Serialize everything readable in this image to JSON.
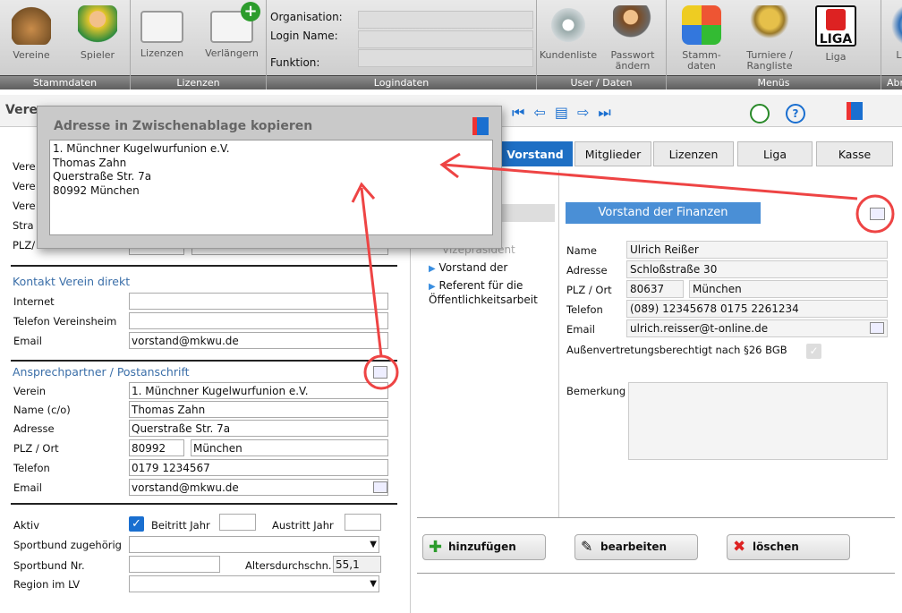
{
  "toolbar": {
    "groups": [
      {
        "footer": "Stammdaten",
        "buttons": [
          "Vereine",
          "Spieler"
        ]
      },
      {
        "footer": "Lizenzen",
        "buttons": [
          "Lizenzen",
          "Verlängern"
        ]
      },
      {
        "footer": "Logindaten",
        "labels": [
          "Organisation:",
          "Login Name:",
          "Funktion:"
        ]
      },
      {
        "footer": "User / Daten",
        "buttons": [
          "Kundenliste",
          "Passwort ändern"
        ]
      },
      {
        "footer": "Menüs",
        "buttons": [
          "Stamm-daten",
          "Turniere / Rangliste",
          "Liga"
        ]
      },
      {
        "footer": "Abr",
        "buttons": [
          "L"
        ]
      }
    ],
    "liga_logo": "LIGA"
  },
  "header": {
    "title": "Vere"
  },
  "popup": {
    "title": "Adresse in Zwischenablage kopieren",
    "lines": [
      "1. Münchner Kugelwurfunion e.V.",
      "Thomas Zahn",
      "Querstraße Str. 7a",
      "80992 München"
    ]
  },
  "left": {
    "top_labels": [
      "Vere",
      "Vere",
      "Vere",
      "Stra",
      "PLZ/"
    ],
    "kontakt": {
      "title": "Kontakt Verein direkt",
      "fields": [
        {
          "label": "Internet",
          "value": ""
        },
        {
          "label": "Telefon Vereinsheim",
          "value": ""
        },
        {
          "label": "Email",
          "value": "vorstand@mkwu.de"
        }
      ]
    },
    "ansprech": {
      "title": "Ansprechpartner / Postanschrift",
      "verein_label": "Verein",
      "verein": "1. Münchner Kugelwurfunion e.V.",
      "name_label": "Name (c/o)",
      "name": "Thomas Zahn",
      "adresse_label": "Adresse",
      "adresse": "Querstraße Str. 7a",
      "plz_label": "PLZ / Ort",
      "plz": "80992",
      "ort": "München",
      "telefon_label": "Telefon",
      "telefon": "0179 1234567",
      "email_label": "Email",
      "email": "vorstand@mkwu.de"
    },
    "aktiv_label": "Aktiv",
    "beitritt_label": "Beitritt Jahr",
    "austritt_label": "Austritt Jahr",
    "sportbund_label": "Sportbund zugehörig",
    "sportbundnr_label": "Sportbund Nr.",
    "alters_label": "Altersdurchschn.",
    "alters_value": "55,1",
    "region_label": "Region im LV"
  },
  "tabs": [
    "Vorstand",
    "Mitglieder",
    "Lizenzen",
    "Liga",
    "Kasse"
  ],
  "vorstand_list": [
    "Vizepräsident",
    "Vorstand der",
    "Referent für die Öffentlichkeitsarbeit"
  ],
  "finanzen": {
    "title": "Vorstand der Finanzen",
    "name_label": "Name",
    "name": "Ulrich Reißer",
    "adresse_label": "Adresse",
    "adresse": "Schloßstraße 30",
    "plz_label": "PLZ / Ort",
    "plz": "80637",
    "ort": "München",
    "telefon_label": "Telefon",
    "telefon": "(089) 12345678 0175 2261234",
    "email_label": "Email",
    "email": "ulrich.reisser@t-online.de",
    "aussen_label": "Außenvertretungsberechtigt nach §26 BGB",
    "bemerkung_label": "Bemerkung"
  },
  "buttons": {
    "add": "hinzufügen",
    "edit": "bearbeiten",
    "delete": "löschen"
  }
}
